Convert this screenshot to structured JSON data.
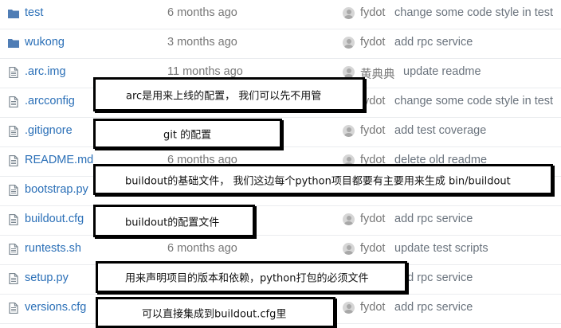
{
  "files": [
    {
      "type": "folder",
      "name": "test",
      "age": "6 months ago",
      "author": "fydot",
      "message": "change some code style in test"
    },
    {
      "type": "folder",
      "name": "wukong",
      "age": "3 months ago",
      "author": "fydot",
      "message": "add rpc service"
    },
    {
      "type": "file",
      "name": ".arc.img",
      "age": "11 months ago",
      "author": "黄典典",
      "message": "update readme"
    },
    {
      "type": "file",
      "name": ".arcconfig",
      "age": "",
      "author": "fydot",
      "message": "change some code style in test"
    },
    {
      "type": "file",
      "name": ".gitignore",
      "age": "",
      "author": "fydot",
      "message": "add test coverage"
    },
    {
      "type": "file",
      "name": "README.md",
      "age": "6 months ago",
      "author": "fydot",
      "message": "delete old readme"
    },
    {
      "type": "file",
      "name": "bootstrap.py",
      "age": "",
      "author": "",
      "message": ""
    },
    {
      "type": "file",
      "name": "buildout.cfg",
      "age": "",
      "author": "fydot",
      "message": "add rpc service"
    },
    {
      "type": "file",
      "name": "runtests.sh",
      "age": "6 months ago",
      "author": "fydot",
      "message": "update test scripts"
    },
    {
      "type": "file",
      "name": "setup.py",
      "age": "",
      "author": "",
      "message": "add rpc service"
    },
    {
      "type": "file",
      "name": "versions.cfg",
      "age": "",
      "author": "fydot",
      "message": "add rpc service"
    }
  ],
  "annotations": [
    {
      "text": "arc是用来上线的配置， 我们可以先不用管"
    },
    {
      "text": "git 的配置"
    },
    {
      "text": "buildout的基础文件， 我们这边每个python项目都要有主要用来生成  bin/buildout"
    },
    {
      "text": "buildout的配置文件"
    },
    {
      "text": "用来声明项目的版本和依赖，python打包的必须文件"
    },
    {
      "text": "可以直接集成到buildout.cfg里"
    }
  ],
  "colors": {
    "link": "#2a6fb7",
    "muted": "#777777",
    "folder_icon": "#4f7db5",
    "file_icon": "#7a8690",
    "annotation_border": "#000000"
  },
  "icons": {
    "folder": "folder-icon",
    "file": "file-icon",
    "avatar": "user-avatar"
  }
}
